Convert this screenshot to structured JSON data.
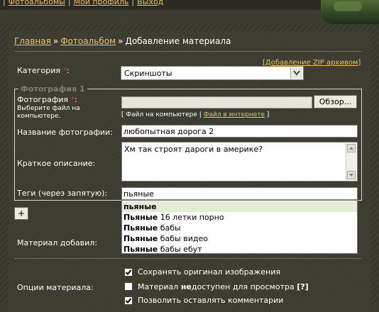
{
  "top_nav": {
    "items": [
      "Фотоальбомы",
      "Мой профиль",
      "Выход"
    ],
    "separator": "|"
  },
  "breadcrumb": {
    "home": "Главная",
    "album": "Фотоальбом",
    "current": "Добавление материала",
    "arrow": "»"
  },
  "zip_link": {
    "open": "[",
    "label": "Добавление ZIP архивом",
    "close": "]"
  },
  "form": {
    "category_label": "Категория",
    "category_suffix": ":",
    "category_value": "Скриншоты",
    "required_mark": "*",
    "photo_section_title": "Фотография 1",
    "photo_label": "Фотография",
    "photo_suffix": ":",
    "photo_hint": "Выберите файл на компьютере.",
    "browse_button": "Обзор...",
    "source_open": "[",
    "source_computer": "Файл на компьютере",
    "source_sep": "|",
    "source_internet": "Файл в интернете",
    "source_close": "]",
    "title_label": "Название фотографии:",
    "title_value": "любопытная дорога 2",
    "description_label": "Краткое описание:",
    "description_value": "Хм так строят дароги в америке?",
    "tags_label": "Теги (через запятую):",
    "tags_value": "пьяные",
    "add_button": "+",
    "added_by_label": "Материал добавил:",
    "options_label": "Опции материала:"
  },
  "suggestions": [
    {
      "bold": "пьяные",
      "rest": ""
    },
    {
      "bold": "Пьяные",
      "rest": " 16 летки порно"
    },
    {
      "bold": "Пьяные",
      "rest": " бабы"
    },
    {
      "bold": "Пьяные",
      "rest": " бабы видео"
    },
    {
      "bold": "Пьяные",
      "rest": " бабы ебут"
    }
  ],
  "options": [
    {
      "pre": "Сохранять оригинал изображения",
      "bold": "",
      "post": "",
      "help": "",
      "checked": true
    },
    {
      "pre": "Материал ",
      "bold": "не",
      "post": "доступен для просмотра ",
      "help": "[?]",
      "checked": false
    },
    {
      "pre": "Позволить оставлять комментарии",
      "bold": "",
      "post": "",
      "help": "",
      "checked": true
    }
  ],
  "colors": {
    "link": "#e6c45a",
    "required": "#e03030",
    "background": "#3b3b30"
  }
}
